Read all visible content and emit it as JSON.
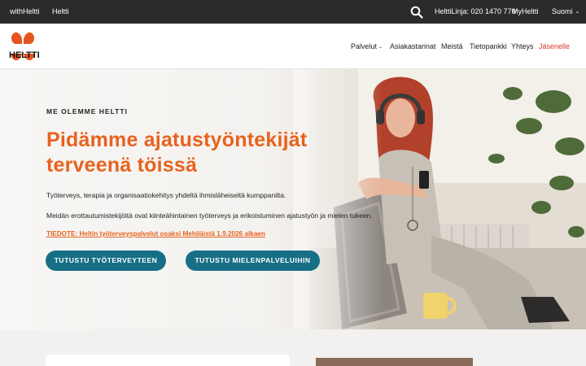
{
  "topbar": {
    "links": [
      "withHeltti",
      "Heltti"
    ],
    "helpline": "HelttiLinja: 020 1470 770",
    "myheltti": "MyHeltti",
    "language": "Suomi",
    "search_icon": "search-icon"
  },
  "header": {
    "logo_text": "HELTTI",
    "nav": [
      "Palvelut",
      "Asiakastarinat",
      "Meistä",
      "Tietopankki",
      "Yhteys",
      "Jäsenelle"
    ]
  },
  "hero": {
    "eyebrow": "ME OLEMME HELTTI",
    "title": "Pidämme ajatustyöntekijät terveenä töissä",
    "para1": "Työterveys, terapia ja organisaatiokehitys yhdeltä ihmisläheiseltä kumppanilta.",
    "para2": "Meidän erottautumistekijöitä ovat kiinteähintainen työterveys ja erikoistuminen ajatustyön ja mielen tukeen.",
    "notice": "TIEDOTE: Heltin työterveyspalvelut osaksi Mehiläistä 1.9.2026 alkaen",
    "buttons": [
      "TUTUSTU TYÖTERVEYTEEN",
      "TUTUSTU MIELENPALVELUIHIN"
    ]
  },
  "colors": {
    "accent": "#e8621e",
    "button": "#176f86",
    "topbar": "#2b2b2b",
    "member_link": "#d83a2a",
    "logo": "#e8541e"
  }
}
